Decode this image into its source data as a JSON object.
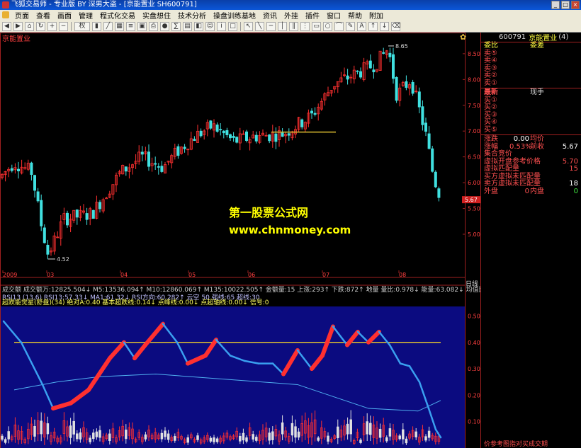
{
  "window": {
    "title": "飞狐交易师 - 专业版 BY 深男大盗 - [京能置业 SH600791]",
    "buttons": [
      "_",
      "□",
      "×"
    ]
  },
  "menu": [
    "页面",
    "查看",
    "画面",
    "管理",
    "程式化交易",
    "实盘想住",
    "技术分析",
    "操盘训练基地",
    "资讯",
    "外挂",
    "插件",
    "窗口",
    "帮助",
    "附加"
  ],
  "toolbar": {
    "period_label": "权"
  },
  "chart": {
    "stock_title": "京能置业",
    "period_label": "日线",
    "price_axis": [
      "8.50",
      "8.00",
      "7.50",
      "7.00",
      "6.50",
      "6.00",
      "5.50",
      "5.00"
    ],
    "current_price_tag": "5.67",
    "high_label": "8.65",
    "low_label": "4.52",
    "date_labels": [
      "2009",
      "03",
      "04",
      "05",
      "06",
      "07",
      "08"
    ],
    "indicator_axis": [
      "0.50",
      "0.40",
      "0.30",
      "0.20",
      "0.10"
    ],
    "volume_line": "成交额 成交额万:12825.504↓ M5:13536.094↑ M10:12860.069↑ M135:10022.505↑ 金额量:15 上涨:293↑ 下跌:872↑ 地量 量比:0.978↓ 能量:63.082↓ 均值比:36.27% 流通值:19.811↓",
    "rsi_line": "RSI13 (13,6) RSI13:57.33↓ MA1:61.32↓ RSI方向:60.282↑ 云空 50 强线:65 超线:30",
    "ind_line": "超跌能觉星(舒盘)(34) 绝对A:0.40 基本超跌线:0.14↓ 点峰线:0.00↓ 点超轴线:0.00↓ 信号:0"
  },
  "quote": {
    "code": "600791",
    "name": "京能置业",
    "num": "(4)",
    "head_left": "委比",
    "head_right": "委差",
    "sell_rows": [
      "卖⑤",
      "卖④",
      "卖③",
      "卖②",
      "卖①"
    ],
    "latest": "最新",
    "current_hand": "现手",
    "buy_rows": [
      "买①",
      "买②",
      "买③",
      "买④",
      "买⑤"
    ],
    "change_label": "涨跌",
    "change_value": "0.00",
    "avg_label": "均价",
    "pct_label": "涨幅",
    "pct_value": "0.53%",
    "prev_label": "前收",
    "prev_value": "5.67",
    "auction_label": "集合竞价",
    "open_ref_label": "虚拟开盘参考价格",
    "open_ref_value": "5.70",
    "match_label": "虚拟匹配量",
    "match_value": "15",
    "buy_unmatched_label": "买方虚拟未匹配量",
    "sell_unmatched_label": "卖方虚拟未匹配量",
    "sell_unmatched_value": "18",
    "outer_label": "外盘",
    "outer_value": "0",
    "inner_label": "内盘",
    "inner_value": "0",
    "footer_text": "价参考图指对买成交期"
  },
  "watermark": {
    "line1": "第一股票公式网",
    "line2": "www.chnmoney.com"
  },
  "colors": {
    "up": "#ff3030",
    "down": "#40e0e0",
    "panel_bg": "#0b0b80",
    "line_yellow": "#e0c030",
    "line_blue": "#3aa0f0"
  }
}
